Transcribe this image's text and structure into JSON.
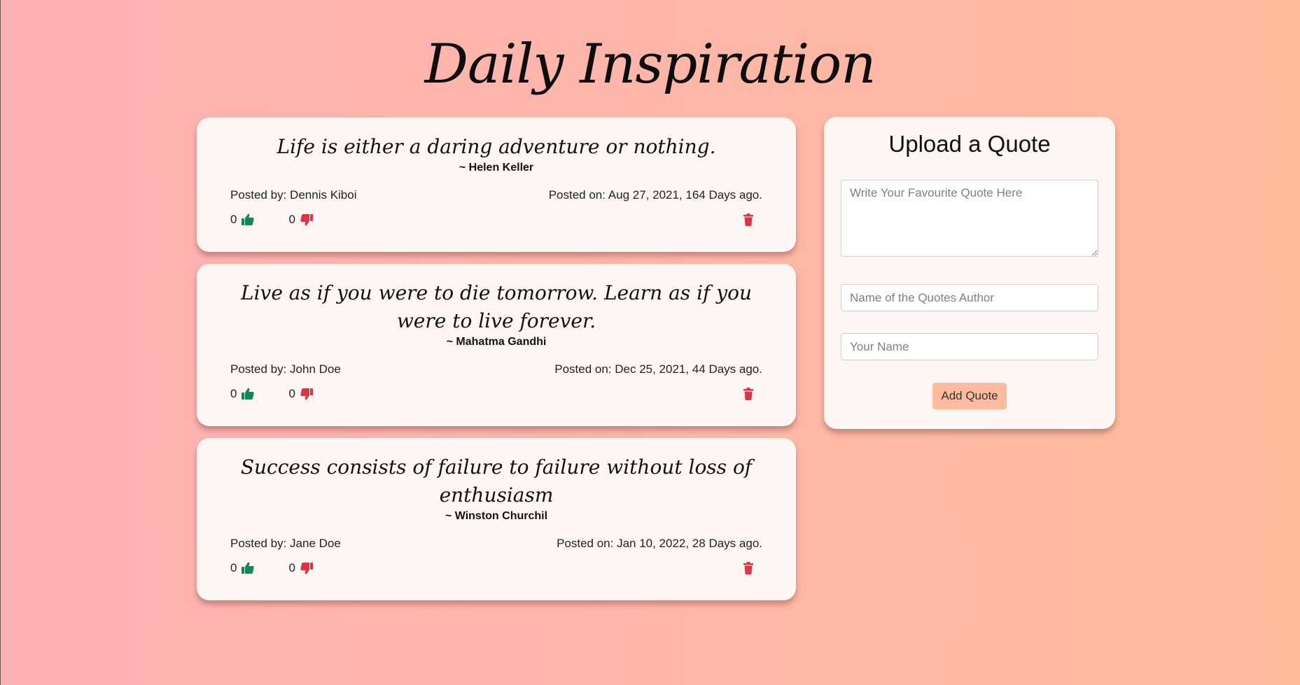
{
  "header": {
    "title": "Daily Inspiration"
  },
  "quotes": [
    {
      "text": "Life is either a daring adventure or nothing.",
      "author": "~ Helen Keller",
      "posted_by": "Posted by: Dennis Kiboi",
      "posted_on": "Posted on: Aug 27, 2021, 164 Days ago.",
      "upvotes": "0",
      "downvotes": "0"
    },
    {
      "text": "Live as if you were to die tomorrow. Learn as if you were to live forever.",
      "author": "~ Mahatma Gandhi",
      "posted_by": "Posted by: John Doe",
      "posted_on": "Posted on: Dec 25, 2021, 44 Days ago.",
      "upvotes": "0",
      "downvotes": "0"
    },
    {
      "text": "Success consists of failure to failure without loss of enthusiasm",
      "author": "~ Winston Churchil",
      "posted_by": "Posted by: Jane Doe",
      "posted_on": "Posted on: Jan 10, 2022, 28 Days ago.",
      "upvotes": "0",
      "downvotes": "0"
    }
  ],
  "upload": {
    "title": "Upload a Quote",
    "quote_placeholder": "Write Your Favourite Quote Here",
    "author_placeholder": "Name of the Quotes Author",
    "name_placeholder": "Your Name",
    "submit_label": "Add Quote"
  },
  "icons": {
    "upvote": "thumbs-up-icon",
    "downvote": "thumbs-down-icon",
    "delete": "trash-icon"
  },
  "colors": {
    "upvote": "#12875a",
    "downvote": "#dc3545",
    "delete": "#dc3545",
    "button": "#ffbb9b",
    "card": "#fdf6f2"
  }
}
